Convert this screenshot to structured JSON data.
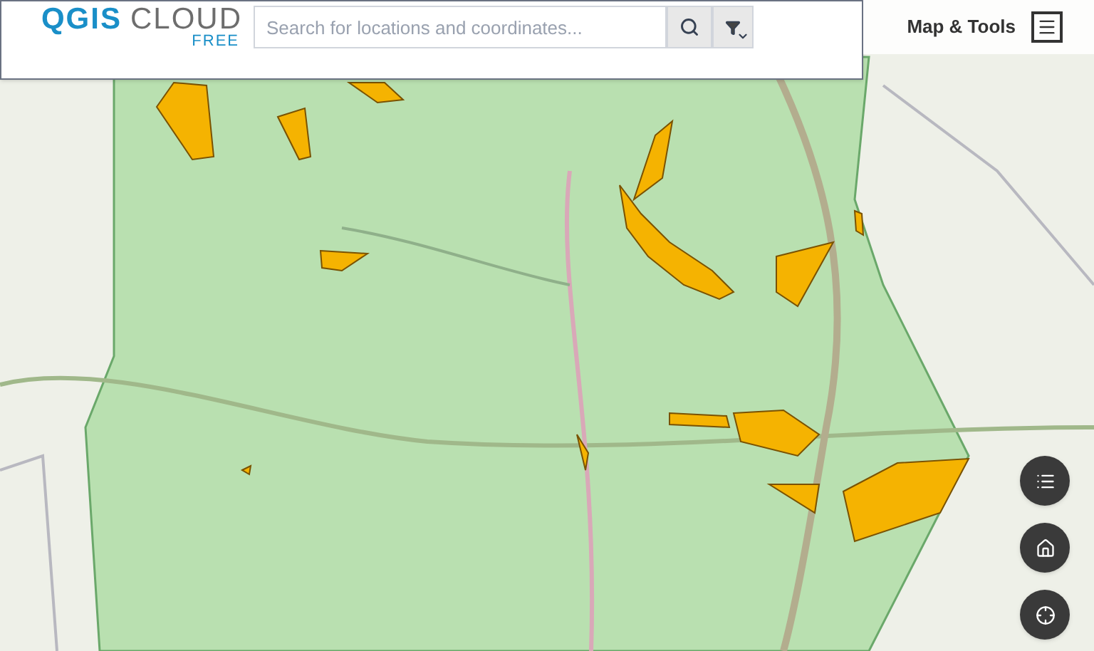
{
  "logo": {
    "primary": "QGIS",
    "secondary": "CLOUD",
    "tag": "FREE"
  },
  "search": {
    "placeholder": "Search for locations and coordinates..."
  },
  "menu": {
    "label": "Map & Tools"
  },
  "map_buttons": [
    {
      "kind": "layers"
    },
    {
      "kind": "home"
    },
    {
      "kind": "locate"
    }
  ]
}
